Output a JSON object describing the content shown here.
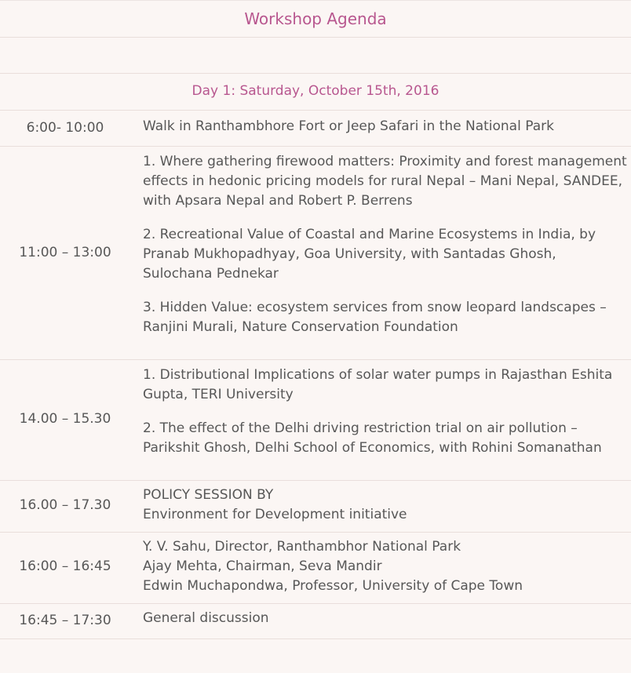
{
  "agenda": {
    "title": "Workshop Agenda",
    "day": "Day 1: Saturday, October 15th, 2016",
    "sessions": [
      {
        "time": "6:00- 10:00",
        "items": [
          "Walk in Ranthambhore Fort or Jeep Safari in the National Park"
        ]
      },
      {
        "time": "11:00 – 13:00",
        "items": [
          "1. Where gathering firewood matters: Proximity and forest management effects in hedonic pricing models for rural Nepal – Mani Nepal, SANDEE, with Apsara Nepal and Robert P. Berrens",
          "2. Recreational Value of Coastal and Marine Ecosystems in India, by Pranab Mukhopadhyay, Goa University, with Santadas Ghosh, Sulochana Pednekar",
          "3. Hidden Value: ecosystem services from snow leopard landscapes – Ranjini Murali, Nature Conservation Foundation"
        ]
      },
      {
        "time": "14.00 – 15.30",
        "items": [
          "1. Distributional Implications of solar water pumps in Rajasthan Eshita Gupta, TERI University",
          "2. The effect of the Delhi driving restriction trial on air pollution – Parikshit Ghosh, Delhi School of Economics, with Rohini Somanathan"
        ]
      },
      {
        "time": "16.00 – 17.30",
        "lines": [
          "POLICY SESSION BY",
          "Environment for Development initiative"
        ]
      },
      {
        "time": "16:00 – 16:45",
        "lines": [
          "Y. V. Sahu, Director, Ranthambhor National Park",
          "Ajay Mehta, Chairman, Seva Mandir",
          "Edwin Muchapondwa, Professor, University of Cape Town"
        ]
      },
      {
        "time": "16:45 – 17:30",
        "items": [
          "General discussion"
        ]
      }
    ]
  }
}
